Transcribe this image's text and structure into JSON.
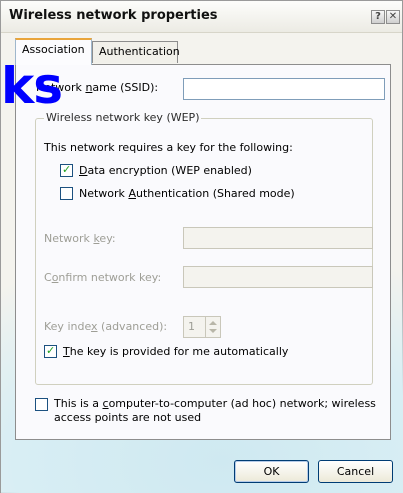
{
  "window": {
    "title": "Wireless network properties",
    "help_glyph": "?",
    "close_glyph": "✕"
  },
  "watermark": "ks",
  "tabs": [
    {
      "label": "Association",
      "selected": true
    },
    {
      "label": "Authentication",
      "selected": false
    }
  ],
  "association": {
    "ssid_label_pre": "Network ",
    "ssid_label_u": "n",
    "ssid_label_post": "ame (SSID):",
    "ssid_value": "",
    "group_title": "Wireless network key (WEP)",
    "requires_text": "This network requires a key for the following:",
    "data_encryption_label_pre": "",
    "data_encryption_label_u": "D",
    "data_encryption_label_post": "ata encryption (WEP enabled)",
    "data_encryption_checked": true,
    "net_auth_label_pre": "Network ",
    "net_auth_label_u": "A",
    "net_auth_label_post": "uthentication (Shared mode)",
    "net_auth_checked": false,
    "network_key_label_pre": "Network ",
    "network_key_label_u": "k",
    "network_key_label_post": "ey:",
    "network_key_value": "",
    "confirm_key_label_pre": "C",
    "confirm_key_label_u": "o",
    "confirm_key_label_post": "nfirm network key:",
    "confirm_key_value": "",
    "key_index_label_pre": "Key inde",
    "key_index_label_u": "x",
    "key_index_label_post": " (advanced):",
    "key_index_value": "1",
    "auto_key_label_pre": "",
    "auto_key_label_u": "T",
    "auto_key_label_post": "he key is provided for me automatically",
    "auto_key_checked": true,
    "adhoc_label_line1_pre": "This is a ",
    "adhoc_label_line1_u": "c",
    "adhoc_label_line1_post": "omputer-to-computer (ad hoc) network; wireless",
    "adhoc_label_line2": "access points are not used",
    "adhoc_checked": false
  },
  "buttons": {
    "ok": "OK",
    "cancel": "Cancel"
  }
}
